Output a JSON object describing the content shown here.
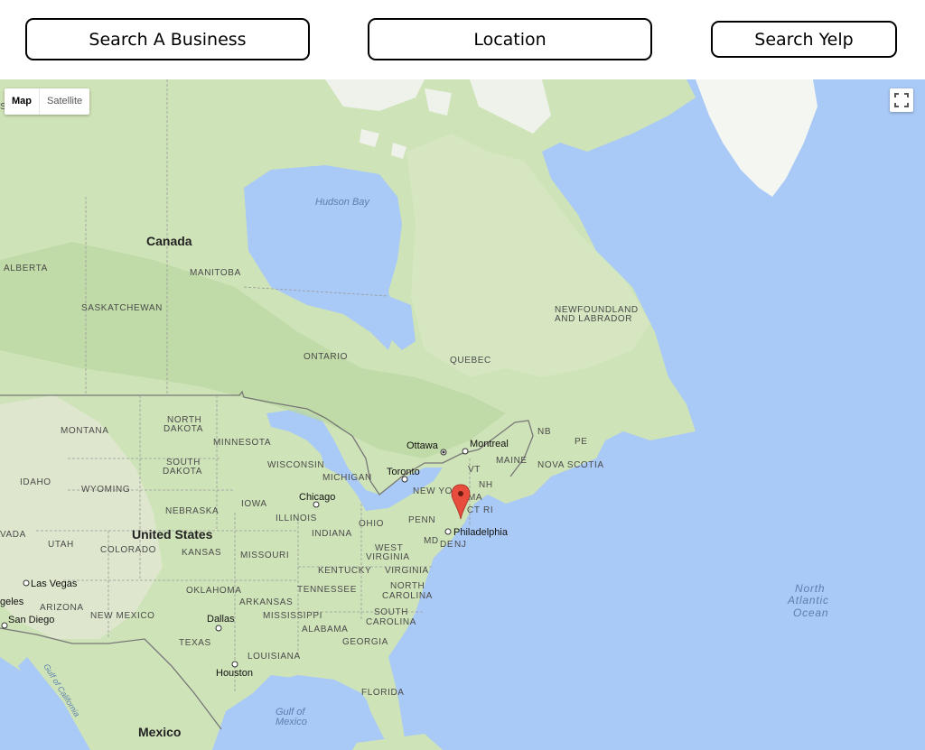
{
  "search": {
    "business_placeholder": "Search A Business",
    "location_placeholder": "Location",
    "submit_label": "Search Yelp"
  },
  "map": {
    "type_controls": {
      "map_label": "Map",
      "satellite_label": "Satellite"
    },
    "fullscreen_icon": "fullscreen-icon",
    "marker_icon": "map-pin-icon",
    "colors": {
      "water": "#a9c9f6",
      "land": "#cfe3b8",
      "marker": "#e74c3c"
    },
    "labels": {
      "hudson_bay": "Hudson Bay",
      "canada": "Canada",
      "alberta": "ALBERTA",
      "manitoba": "MANITOBA",
      "saskatchewan": "SASKATCHEWAN",
      "ontario": "ONTARIO",
      "quebec": "QUEBEC",
      "newfoundland_1": "NEWFOUNDLAND",
      "newfoundland_2": "AND LABRADOR",
      "north_dakota_1": "NORTH",
      "north_dakota_2": "DAKOTA",
      "montana": "MONTANA",
      "minnesota": "MINNESOTA",
      "south_dakota_1": "SOUTH",
      "south_dakota_2": "DAKOTA",
      "wisconsin": "WISCONSIN",
      "michigan": "MICHIGAN",
      "idaho": "IDAHO",
      "wyoming": "WYOMING",
      "nebraska": "NEBRASKA",
      "iowa": "IOWA",
      "illinois": "ILLINOIS",
      "indiana": "INDIANA",
      "ohio": "OHIO",
      "penn": "PENN",
      "new_york": "NEW YORK",
      "vada": "VADA",
      "utah": "UTAH",
      "colorado": "COLORADO",
      "kansas": "KANSAS",
      "missouri": "MISSOURI",
      "kentucky": "KENTUCKY",
      "virginia": "VIRGINIA",
      "west_virginia_1": "WEST",
      "west_virginia_2": "VIRGINIA",
      "united_states": "United States",
      "oklahoma": "OKLAHOMA",
      "arkansas": "ARKANSAS",
      "tennessee": "TENNESSEE",
      "north_carolina_1": "NORTH",
      "north_carolina_2": "CAROLINA",
      "arizona": "ARIZONA",
      "new_mexico": "NEW MEXICO",
      "mississippi": "MISSISSIPPI",
      "alabama": "ALABAMA",
      "south_carolina_1": "SOUTH",
      "south_carolina_2": "CAROLINA",
      "georgia": "GEORGIA",
      "texas": "TEXAS",
      "louisiana": "LOUISIANA",
      "florida": "FLORIDA",
      "mexico": "Mexico",
      "gulf_of_mexico_1": "Gulf of",
      "gulf_of_mexico_2": "Mexico",
      "gulf_of_california": "Gulf of California",
      "north_atlantic_1": "North",
      "north_atlantic_2": "Atlantic",
      "north_atlantic_3": "Ocean",
      "nb": "NB",
      "pe": "PE",
      "maine": "MAINE",
      "nova_scotia": "NOVA SCOTIA",
      "vt": "VT",
      "nh": "NH",
      "ma": "MA",
      "ct": "CT",
      "ri": "RI",
      "md": "MD",
      "de": "DE",
      "nj": "NJ",
      "geles": "geles",
      "s_edge": "S"
    },
    "cities": {
      "ottawa": "Ottawa",
      "montreal": "Montreal",
      "toronto": "Toronto",
      "chicago": "Chicago",
      "philadelphia": "Philadelphia",
      "las_vegas": "Las Vegas",
      "san_diego": "San Diego",
      "dallas": "Dallas",
      "houston": "Houston"
    }
  }
}
